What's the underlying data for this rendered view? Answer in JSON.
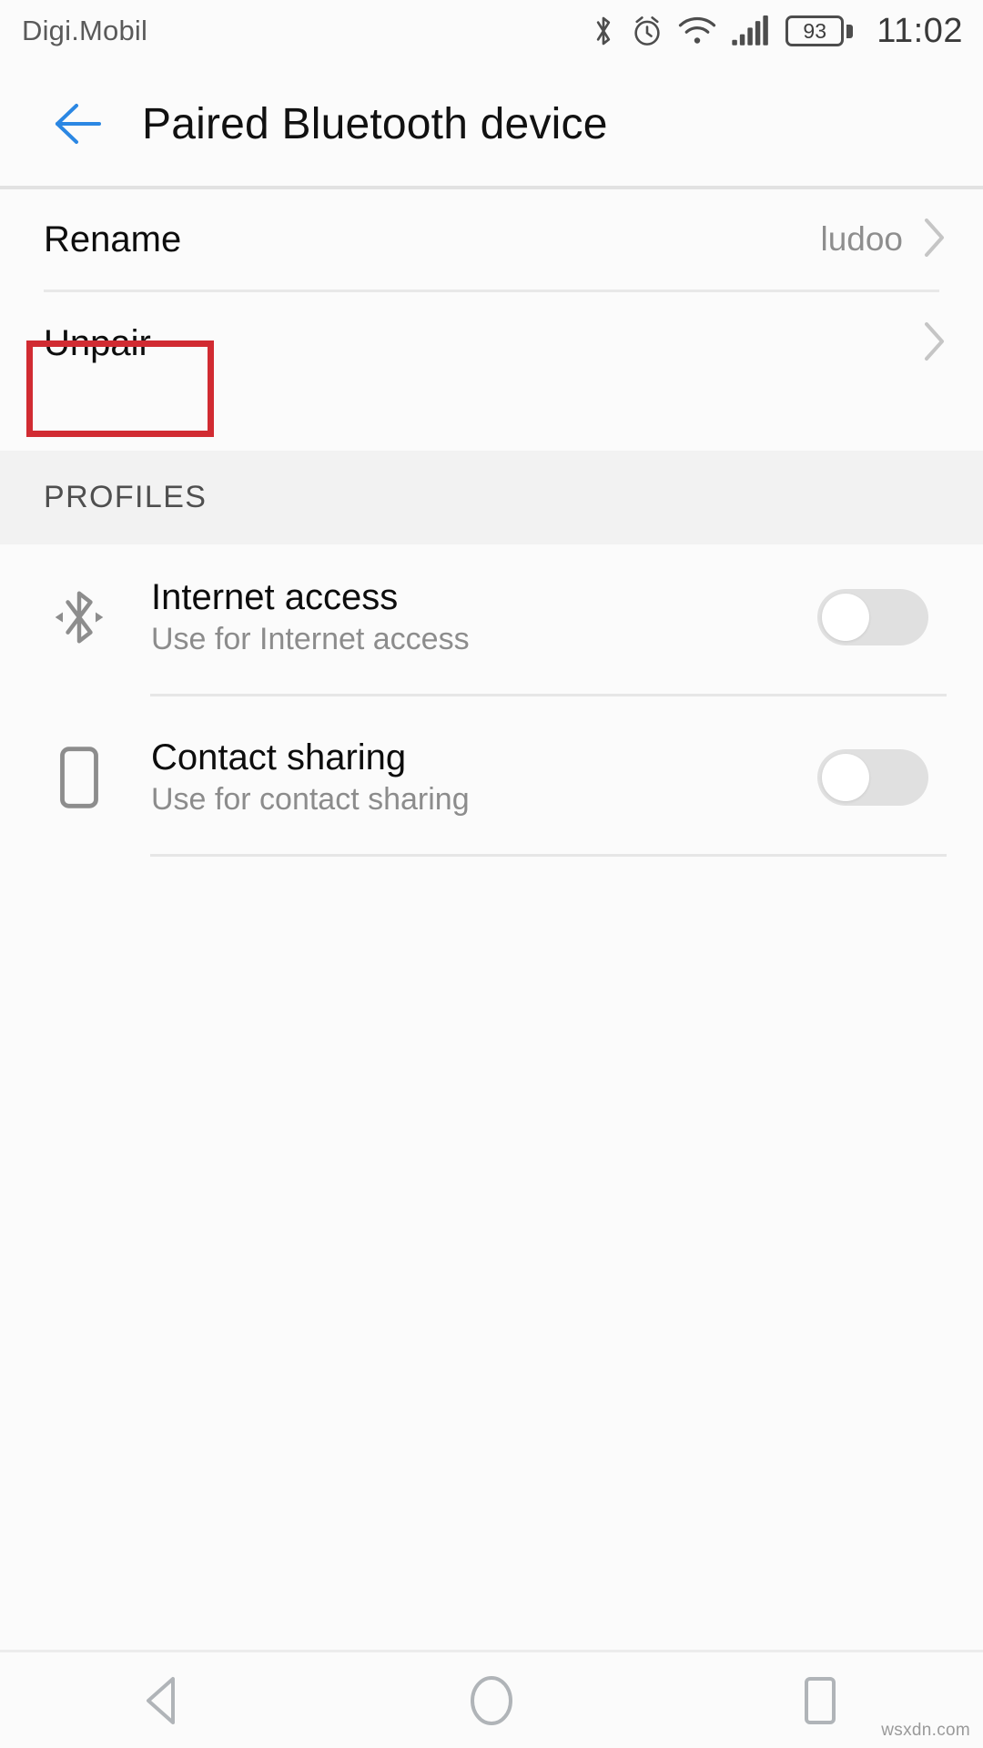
{
  "status_bar": {
    "carrier": "Digi.Mobil",
    "battery_percent": "93",
    "time": "11:02",
    "icons": [
      "bluetooth-icon",
      "alarm-icon",
      "wifi-icon",
      "cellular-signal-icon",
      "battery-icon"
    ]
  },
  "header": {
    "back_icon": "arrow-left-icon",
    "title": "Paired Bluetooth device",
    "accent_color": "#2b87e3"
  },
  "settings_rows": [
    {
      "label": "Rename",
      "value": "ludoo",
      "chevron": "chevron-right-icon"
    },
    {
      "label": "Unpair",
      "value": "",
      "chevron": "chevron-right-icon",
      "highlighted": true
    }
  ],
  "annotation": {
    "color": "#d12b32",
    "target": "Unpair"
  },
  "profiles_section": {
    "header": "PROFILES",
    "items": [
      {
        "icon": "bluetooth-tethering-icon",
        "title": "Internet access",
        "subtitle": "Use for Internet access",
        "toggle_state": "off"
      },
      {
        "icon": "phone-device-icon",
        "title": "Contact sharing",
        "subtitle": "Use for contact sharing",
        "toggle_state": "off"
      }
    ]
  },
  "nav_bar": {
    "buttons": [
      {
        "name": "back-nav-button",
        "icon": "triangle-left-icon"
      },
      {
        "name": "home-nav-button",
        "icon": "circle-icon"
      },
      {
        "name": "recents-nav-button",
        "icon": "square-icon"
      }
    ]
  },
  "watermark": "wsxdn.com"
}
